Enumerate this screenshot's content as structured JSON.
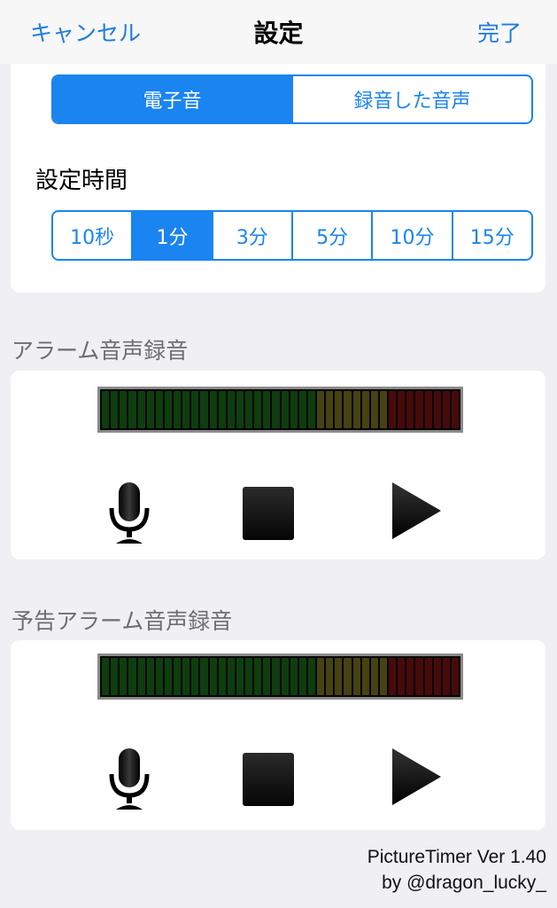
{
  "nav": {
    "cancel": "キャンセル",
    "title": "設定",
    "done": "完了"
  },
  "sound_type": {
    "options": [
      "電子音",
      "録音した音声"
    ],
    "selected": "電子音"
  },
  "duration": {
    "label": "設定時間",
    "options": [
      "10秒",
      "1分",
      "3分",
      "5分",
      "10分",
      "15分"
    ],
    "selected": "1分"
  },
  "alarm_recording": {
    "label": "アラーム音声録音",
    "level": 0
  },
  "warning_recording": {
    "label": "予告アラーム音声録音",
    "level": 0
  },
  "footer": {
    "version": "PictureTimer Ver 1.40",
    "credit": "by @dragon_lucky_"
  },
  "colors": {
    "accent": "#1a84f0",
    "meter_green": "#0e3d0e",
    "meter_yellow": "#474212",
    "meter_red": "#470a0a"
  },
  "icons": [
    "microphone-icon",
    "stop-icon",
    "play-icon"
  ]
}
